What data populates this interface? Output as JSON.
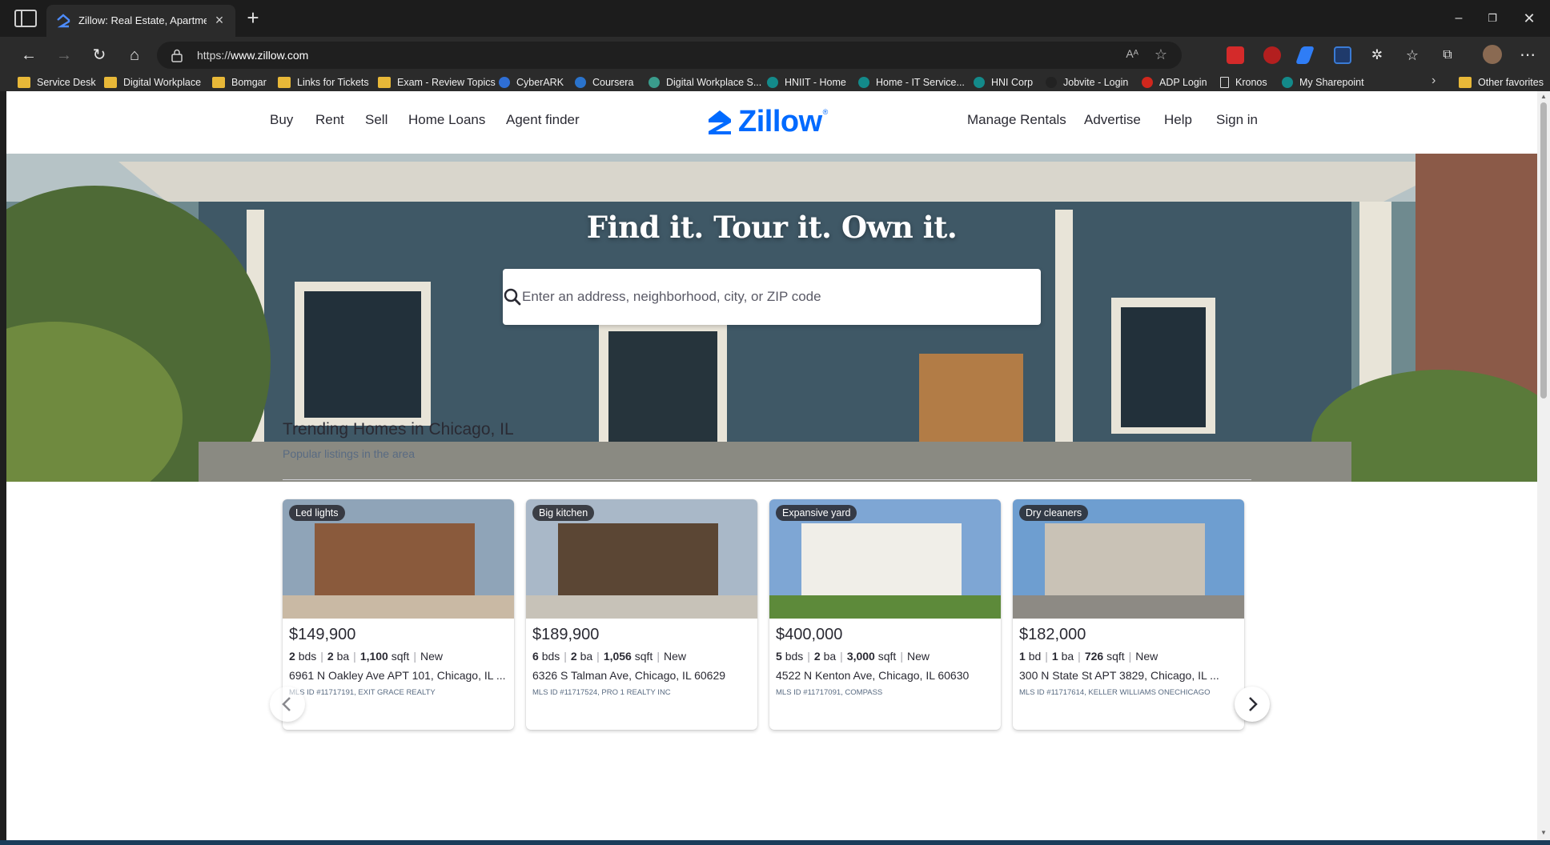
{
  "browser": {
    "tab_title": "Zillow: Real Estate, Apartments, M",
    "url_prefix": "https://",
    "url_host": "www.zillow.com",
    "read_aloud": "Aᴬ",
    "bookmarks": [
      {
        "label": "Service Desk",
        "icon": "folder"
      },
      {
        "label": "Digital Workplace",
        "icon": "folder"
      },
      {
        "label": "Bomgar",
        "icon": "folder"
      },
      {
        "label": "Links for Tickets",
        "icon": "folder"
      },
      {
        "label": "Exam - Review Topics",
        "icon": "folder"
      },
      {
        "label": "CyberARK",
        "icon": "cyberark"
      },
      {
        "label": "Coursera",
        "icon": "coursera"
      },
      {
        "label": "Digital Workplace S...",
        "icon": "site"
      },
      {
        "label": "HNIIT - Home",
        "icon": "sharepoint"
      },
      {
        "label": "Home - IT Service...",
        "icon": "sharepoint"
      },
      {
        "label": "HNI Corp",
        "icon": "sharepoint"
      },
      {
        "label": "Jobvite - Login",
        "icon": "jobvite"
      },
      {
        "label": "ADP Login",
        "icon": "adp"
      },
      {
        "label": "Kronos",
        "icon": "page"
      },
      {
        "label": "My Sharepoint",
        "icon": "sharepoint"
      }
    ],
    "other_favorites": "Other favorites"
  },
  "nav": {
    "left": [
      "Buy",
      "Rent",
      "Sell",
      "Home Loans",
      "Agent finder"
    ],
    "logo": "Zillow",
    "logo_mark": "®",
    "right": [
      "Manage Rentals",
      "Advertise",
      "Help",
      "Sign in"
    ]
  },
  "hero": {
    "headline": "Find it. Tour it. Own it.",
    "search_placeholder": "Enter an address, neighborhood, city, or ZIP code"
  },
  "trending": {
    "title": "Trending Homes in Chicago, IL",
    "subtitle": "Popular listings in the area",
    "listings": [
      {
        "tag": "Led lights",
        "price": "$149,900",
        "beds": "2",
        "beds_unit": "bds",
        "baths": "2",
        "baths_unit": "ba",
        "sqft": "1,100",
        "sqft_unit": "sqft",
        "status": "New",
        "address": "6961 N Oakley Ave APT 101, Chicago, IL ...",
        "mls": "MLS ID #11717191, EXIT GRACE REALTY"
      },
      {
        "tag": "Big kitchen",
        "price": "$189,900",
        "beds": "6",
        "beds_unit": "bds",
        "baths": "2",
        "baths_unit": "ba",
        "sqft": "1,056",
        "sqft_unit": "sqft",
        "status": "New",
        "address": "6326 S Talman Ave, Chicago, IL 60629",
        "mls": "MLS ID #11717524, PRO 1 REALTY INC"
      },
      {
        "tag": "Expansive yard",
        "price": "$400,000",
        "beds": "5",
        "beds_unit": "bds",
        "baths": "2",
        "baths_unit": "ba",
        "sqft": "3,000",
        "sqft_unit": "sqft",
        "status": "New",
        "address": "4522 N Kenton Ave, Chicago, IL 60630",
        "mls": "MLS ID #11717091, COMPASS"
      },
      {
        "tag": "Dry cleaners",
        "price": "$182,000",
        "beds": "1",
        "beds_unit": "bd",
        "baths": "1",
        "baths_unit": "ba",
        "sqft": "726",
        "sqft_unit": "sqft",
        "status": "New",
        "address": "300 N State St APT 3829, Chicago, IL ...",
        "mls": "MLS ID #11717614, KELLER WILLIAMS ONECHICAGO"
      }
    ]
  },
  "colors": {
    "brand": "#006aff",
    "text": "#2a2a33",
    "muted": "#596b82"
  }
}
